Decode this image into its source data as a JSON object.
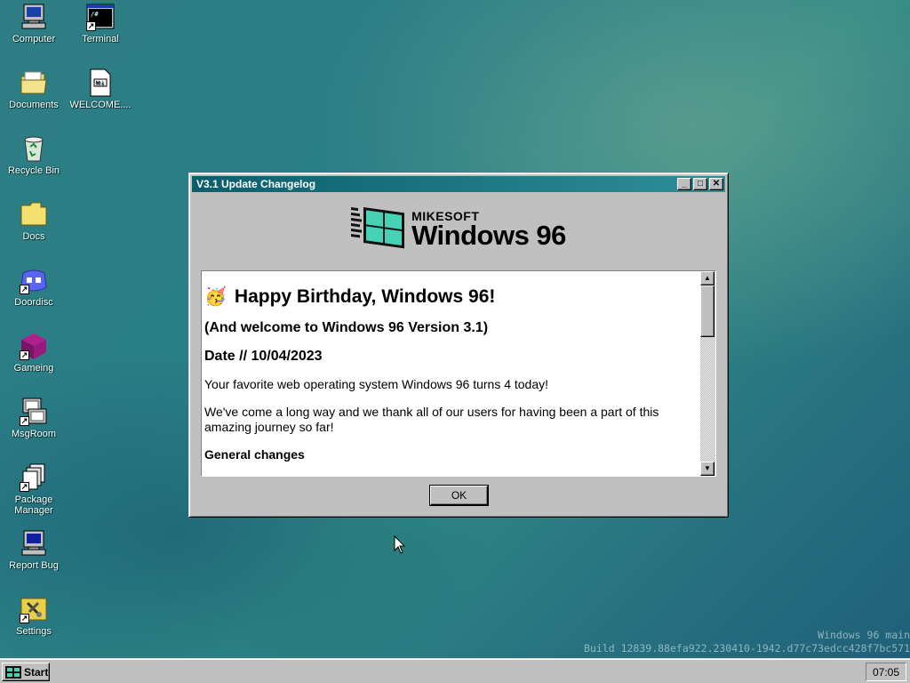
{
  "desktop": {
    "icons": [
      {
        "label": "Computer",
        "icon": "computer-icon"
      },
      {
        "label": "Terminal",
        "icon": "terminal-icon"
      },
      {
        "label": "Documents",
        "icon": "folder-icon"
      },
      {
        "label": "WELCOME....",
        "icon": "markdown-file-icon"
      },
      {
        "label": "Recycle Bin",
        "icon": "recycle-bin-icon"
      },
      {
        "label": "Docs",
        "icon": "folder-icon"
      },
      {
        "label": "Doordisc",
        "icon": "doordisc-icon"
      },
      {
        "label": "Gameing",
        "icon": "cube-icon"
      },
      {
        "label": "MsgRoom",
        "icon": "msgroom-icon"
      },
      {
        "label": "Package Manager",
        "icon": "package-manager-icon"
      },
      {
        "label": "Report Bug",
        "icon": "report-bug-icon"
      },
      {
        "label": "Settings",
        "icon": "settings-icon"
      }
    ]
  },
  "window": {
    "title": "V3.1 Update Changelog",
    "controls": {
      "minimize": "_",
      "maximize": "□",
      "close": "✕"
    },
    "logo": {
      "brand": "MIKESOFT",
      "product": "Windows 96"
    },
    "content": {
      "heading_emoji": "🥳",
      "heading": "Happy Birthday, Windows 96!",
      "subheading": "(And welcome to Windows 96 Version 3.1)",
      "date": "Date // 10/04/2023",
      "para1": "Your favorite web operating system Windows 96 turns 4 today!",
      "para2": "We've come a long way and we thank all of our users for having been a part of this amazing journey so far!",
      "section": "General changes"
    },
    "ok_label": "OK"
  },
  "watermark": {
    "line1": "Windows 96 main",
    "line2": "Build 12839.88efa922.230410-1942.d77c73edcc428f7bc571"
  },
  "taskbar": {
    "start_label": "Start",
    "clock": "07:05"
  },
  "colors": {
    "titlebar_start": "#0a5e6c",
    "titlebar_end": "#2e8f99",
    "desktop": "#2a7f86",
    "logo_teal": "#46d3b5"
  }
}
